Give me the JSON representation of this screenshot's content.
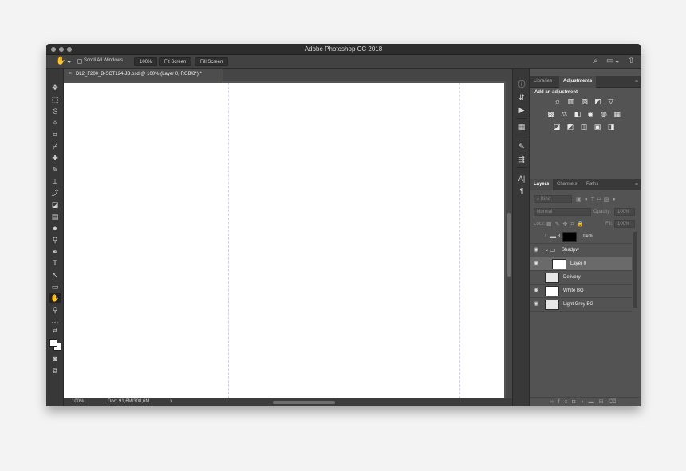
{
  "window": {
    "title": "Adobe Photoshop CC 2018"
  },
  "options_bar": {
    "scroll_all_windows": "Scroll All Windows",
    "zoom_100": "100%",
    "fit_screen": "Fit Screen",
    "fill_screen": "Fill Screen"
  },
  "document": {
    "tab_title": "DL2_F200_B-SCT124-JB.psd @ 100% (Layer 0, RGB/8*) *",
    "close_glyph": "×"
  },
  "status_bar": {
    "zoom": "100%",
    "doc_info": "Doc: 91,6M/308,6M",
    "arrow": "›"
  },
  "top_panel": {
    "tabs": [
      "Libraries",
      "Adjustments"
    ],
    "active_tab": "Adjustments",
    "add_adjustment_label": "Add an adjustment"
  },
  "layers_panel": {
    "tabs": [
      "Layers",
      "Channels",
      "Paths"
    ],
    "active_tab": "Layers",
    "kind_placeholder": "Kind",
    "blend_mode": "Normal",
    "opacity_label": "Opacity:",
    "opacity_value": "100%",
    "lock_label": "Lock:",
    "fill_label": "Fill:",
    "fill_value": "100%",
    "layers": [
      {
        "name": "Item",
        "type": "group",
        "visible": false,
        "expanded": false
      },
      {
        "name": "Shadpw",
        "type": "group",
        "visible": true,
        "expanded": true
      },
      {
        "name": "Layer 0",
        "type": "layer",
        "visible": true,
        "selected": true
      },
      {
        "name": "Delivery",
        "type": "layer",
        "visible": false
      },
      {
        "name": "White BG",
        "type": "layer",
        "visible": true
      },
      {
        "name": "Light Grey BG",
        "type": "layer",
        "visible": true
      }
    ]
  },
  "icons": {
    "hand": "hand-icon",
    "search": "search-icon",
    "workspace": "workspace-icon",
    "share": "share-icon"
  },
  "colors": {
    "ui_dark": "#383838",
    "ui_mid": "#535353",
    "titlebar": "#2d2d2d",
    "canvas": "#ffffff",
    "selected_layer": "#6a6a6a"
  }
}
